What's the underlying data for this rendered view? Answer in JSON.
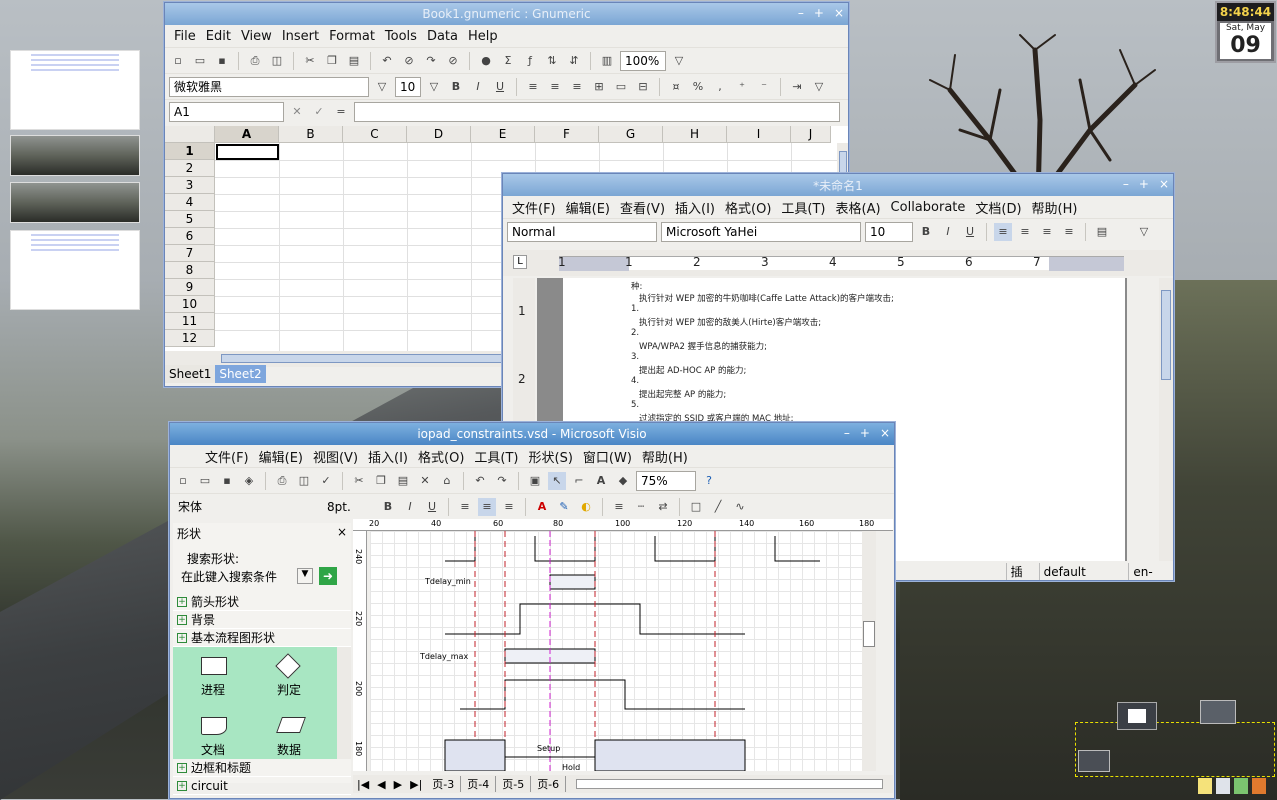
{
  "clock": {
    "time": "8:48:44",
    "weekday_month": "Sat, May",
    "day": "09"
  },
  "gnumeric": {
    "title": "Book1.gnumeric : Gnumeric",
    "menu": [
      "File",
      "Edit",
      "View",
      "Insert",
      "Format",
      "Tools",
      "Data",
      "Help"
    ],
    "zoom": "100%",
    "font_name": "微软雅黑",
    "font_size": "10",
    "cell_ref": "A1",
    "formula_eq": "=",
    "columns": [
      "A",
      "B",
      "C",
      "D",
      "E",
      "F",
      "G",
      "H",
      "I",
      "J"
    ],
    "rows": [
      "1",
      "2",
      "3",
      "4",
      "5",
      "6",
      "7",
      "8",
      "9",
      "10",
      "11",
      "12"
    ],
    "sheets": [
      "Sheet1",
      "Sheet2"
    ]
  },
  "abiword": {
    "title": "*未命名1",
    "menu": [
      "文件(F)",
      "编辑(E)",
      "查看(V)",
      "插入(I)",
      "格式(O)",
      "工具(T)",
      "表格(A)",
      "Collaborate",
      "文档(D)",
      "帮助(H)"
    ],
    "style": "Normal",
    "font": "Microsoft YaHei",
    "size": "10",
    "ruler": [
      "1",
      "1",
      "2",
      "3",
      "4",
      "5",
      "6",
      "7"
    ],
    "vruler": [
      "1",
      "2"
    ],
    "lines": [
      {
        "text": "种:"
      },
      {
        "text": "执行针对 WEP 加密的牛奶咖啡(Caffe Latte Attack)的客户端攻击;"
      },
      {
        "num": "1."
      },
      {
        "text": "执行针对 WEP 加密的敌美人(Hirte)客户端攻击;"
      },
      {
        "num": "2."
      },
      {
        "text": "WPA/WPA2 握手信息的捕获能力;"
      },
      {
        "num": "3."
      },
      {
        "text": "提出起 AD-HOC AP 的能力;"
      },
      {
        "num": "4."
      },
      {
        "text": "提出起完整 AP 的能力;"
      },
      {
        "num": "5."
      },
      {
        "text": "过滤指定的 SSID 或客户端的 MAC 地址;"
      }
    ],
    "status": {
      "mode": "插入",
      "style": "default",
      "lang": "en-US"
    }
  },
  "visio": {
    "title": "iopad_constraints.vsd - Microsoft Visio",
    "menu": [
      "文件(F)",
      "编辑(E)",
      "视图(V)",
      "插入(I)",
      "格式(O)",
      "工具(T)",
      "形状(S)",
      "窗口(W)",
      "帮助(H)"
    ],
    "zoom": "75%",
    "font": "宋体",
    "size": "8pt.",
    "shapes_title": "形状",
    "search_label": "搜索形状:",
    "search_placeholder": "在此键入搜索条件",
    "categories_top": [
      "箭头形状",
      "背景",
      "基本流程图形状"
    ],
    "stencil": [
      "进程",
      "判定",
      "文档",
      "数据"
    ],
    "categories_bottom": [
      "边框和标题",
      "circuit"
    ],
    "ruler_x": [
      "20",
      "40",
      "60",
      "80",
      "100",
      "120",
      "140",
      "160",
      "180"
    ],
    "ruler_y": [
      "240",
      "220",
      "200",
      "180"
    ],
    "labels": {
      "tmin": "Tdelay_min",
      "tmax": "Tdelay_max",
      "setup": "Setup",
      "hold": "Hold"
    },
    "pages": [
      "页-3",
      "页-4",
      "页-5",
      "页-6"
    ]
  }
}
